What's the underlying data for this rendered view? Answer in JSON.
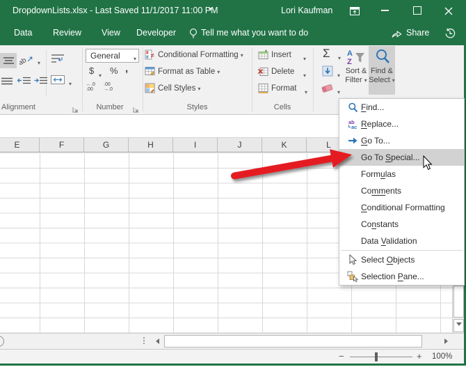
{
  "titlebar": {
    "title": "DropdownLists.xlsx  -  Last Saved 11/1/2017 11:00 PM",
    "user": "Lori Kaufman"
  },
  "tabs": [
    {
      "label": "Data"
    },
    {
      "label": "Review"
    },
    {
      "label": "View"
    },
    {
      "label": "Developer"
    }
  ],
  "tell_me": "Tell me what you want to do",
  "share_label": "Share",
  "ribbon": {
    "alignment": {
      "label": "Alignment"
    },
    "number": {
      "label": "Number",
      "format_value": "General",
      "currency": "$",
      "percent": "%",
      "comma": ",",
      "increase_decimal": "←.0\n.00",
      "decrease_decimal": ".00\n→.0"
    },
    "styles": {
      "label": "Styles",
      "conditional_formatting": "Conditional Formatting",
      "format_as_table": "Format as Table",
      "cell_styles": "Cell Styles"
    },
    "cells": {
      "label": "Cells",
      "insert": "Insert",
      "delete": "Delete",
      "format": "Format"
    },
    "editing": {
      "autosum": "Σ",
      "sort_line1": "Sort &",
      "sort_line2": "Filter",
      "find_line1": "Find &",
      "find_line2": "Select"
    }
  },
  "sheet": {
    "columns": [
      "E",
      "F",
      "G",
      "H",
      "I",
      "J",
      "K",
      "L"
    ]
  },
  "menu": {
    "items": [
      {
        "prefix": "",
        "key": "F",
        "suffix": "ind...",
        "icon": "find"
      },
      {
        "prefix": "",
        "key": "R",
        "suffix": "eplace...",
        "icon": "replace"
      },
      {
        "prefix": "",
        "key": "G",
        "suffix": "o To...",
        "icon": "go-to"
      },
      {
        "prefix": "Go To ",
        "key": "S",
        "suffix": "pecial...",
        "highlighted": true
      },
      {
        "prefix": "Form",
        "key": "u",
        "suffix": "las"
      },
      {
        "prefix": "Co",
        "key": "mm",
        "suffix": "ents"
      },
      {
        "prefix": "",
        "key": "C",
        "suffix": "onditional Formatting"
      },
      {
        "prefix": "Co",
        "key": "n",
        "suffix": "stants"
      },
      {
        "prefix": "Data ",
        "key": "V",
        "suffix": "alidation"
      },
      {
        "prefix": "Select ",
        "key": "O",
        "suffix": "bjects",
        "icon": "select-objects"
      },
      {
        "prefix": "Selection ",
        "key": "P",
        "suffix": "ane...",
        "icon": "selection-pane"
      }
    ]
  },
  "status": {
    "zoom_level": "100%"
  },
  "colors": {
    "excel_green": "#217346",
    "ribbon_bg": "#f1f1f1",
    "find_select_pressed_bg": "#d0d0d0",
    "menu_highlight_bg": "#d2d2d2",
    "arrow_red": "#e41e20"
  }
}
